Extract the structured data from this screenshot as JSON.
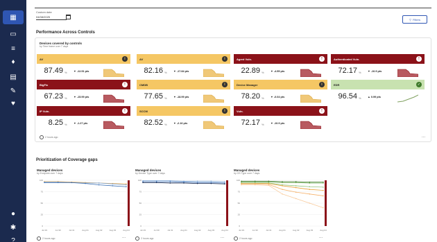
{
  "sidebar": {
    "icons": [
      "dashboard-icon",
      "devices-icon",
      "servers-icon",
      "alerts-icon",
      "reports-icon",
      "tools-icon",
      "shield-icon",
      "user-icon",
      "settings-icon",
      "help-icon"
    ]
  },
  "date_picker": {
    "label": "Custom date",
    "value": "04/08/2025"
  },
  "filters_label": "Filters",
  "performance": {
    "title": "Performance Across Controls",
    "card_title": "Devices covered by controls",
    "card_subtitle": "by Time frame over 7 days",
    "updated": "2 hours ago",
    "tiles": [
      {
        "name": "AV",
        "value": "87.49",
        "delta": "-12.51",
        "tone": "yellow",
        "status": "i",
        "trend": "down"
      },
      {
        "name": "AV",
        "value": "82.16",
        "delta": "-17.84",
        "tone": "yellow",
        "status": "i",
        "trend": "down"
      },
      {
        "name": "Agent Vuln.",
        "value": "22.89",
        "delta": "-4.55",
        "tone": "red",
        "status": "!",
        "trend": "down"
      },
      {
        "name": "Authenticated Vuln.",
        "value": "72.17",
        "delta": "-10.9",
        "tone": "red",
        "status": "!",
        "trend": "down"
      },
      {
        "name": "BigFix",
        "value": "67.23",
        "delta": "-15.99",
        "tone": "red",
        "status": "!",
        "trend": "down"
      },
      {
        "name": "CMDB",
        "value": "77.65",
        "delta": "-18.99",
        "tone": "yellow",
        "status": "i",
        "trend": "down"
      },
      {
        "name": "Device Manager",
        "value": "78.20",
        "delta": "-0.04",
        "tone": "yellow",
        "status": "i",
        "trend": "down"
      },
      {
        "name": "EDR",
        "value": "96.54",
        "delta": "0.99",
        "tone": "green",
        "status": "✓",
        "trend": "up"
      },
      {
        "name": "IP Vuln.",
        "value": "8.25",
        "delta": "-1.27",
        "tone": "red",
        "status": "!",
        "trend": "down"
      },
      {
        "name": "SCCM",
        "value": "82.52",
        "delta": "-2.16",
        "tone": "yellow",
        "status": "i",
        "trend": "down"
      },
      {
        "name": "Vuln.",
        "value": "72.17",
        "delta": "-10.9",
        "tone": "red",
        "status": "!",
        "trend": "down"
      }
    ],
    "pct_unit": "%",
    "delta_unit": "pts",
    "colors": {
      "yellow": "#f5c764",
      "red": "#8b1219",
      "green": "#c8e2b0",
      "nav": "#1b2a4e",
      "accent": "#2f56b3"
    }
  },
  "gaps": {
    "title": "Prioritization of Coverage gaps",
    "updated": "2 hours ago"
  },
  "chart_data": [
    {
      "type": "line",
      "title": "Managed devices",
      "subtitle": "by Endpoint over 7 days",
      "x": [
        "Jul 29",
        "Jul 30",
        "Jul 31",
        "Aug 01",
        "Aug 02",
        "Aug 03",
        "Aug 04"
      ],
      "ylim": [
        0,
        100
      ],
      "series": [
        {
          "values": [
            97,
            97,
            96,
            95,
            94,
            93,
            92
          ],
          "color": "#e8a23c"
        },
        {
          "values": [
            96,
            96,
            95,
            94,
            94,
            92,
            90
          ],
          "color": "#7fa8d8"
        },
        {
          "values": [
            95,
            95,
            95,
            93,
            90,
            88,
            86
          ],
          "color": "#3a6fb5"
        }
      ]
    },
    {
      "type": "line",
      "title": "Managed devices",
      "subtitle": "by Device Type over 7 days",
      "x": [
        "Jul 29",
        "Jul 30",
        "Jul 31",
        "Aug 01",
        "Aug 02",
        "Aug 03",
        "Aug 04"
      ],
      "ylim": [
        0,
        100
      ],
      "series": [
        {
          "values": [
            99,
            99,
            99,
            98,
            98,
            98,
            97
          ],
          "color": "#7fa8d8"
        },
        {
          "values": [
            97,
            97,
            97,
            96,
            95,
            95,
            94
          ],
          "color": "#3a6fb5"
        },
        {
          "values": [
            95,
            95,
            94,
            94,
            93,
            93,
            92
          ],
          "color": "#1b2a4e"
        }
      ]
    },
    {
      "type": "line",
      "title": "Managed devices",
      "subtitle": "by OS Type over 7 days",
      "x": [
        "Jul 29",
        "Jul 30",
        "Jul 31",
        "Aug 01",
        "Aug 02",
        "Aug 03",
        "Aug 04"
      ],
      "ylim": [
        0,
        100
      ],
      "series": [
        {
          "values": [
            98,
            98,
            98,
            97,
            97,
            96,
            96
          ],
          "color": "#3f7a2b"
        },
        {
          "values": [
            96,
            96,
            96,
            95,
            95,
            94,
            94
          ],
          "color": "#6aa84f"
        },
        {
          "values": [
            94,
            94,
            94,
            90,
            88,
            86,
            85
          ],
          "color": "#93c47d"
        },
        {
          "values": [
            93,
            93,
            93,
            88,
            84,
            80,
            78
          ],
          "color": "#e8a23c"
        },
        {
          "values": [
            92,
            92,
            91,
            80,
            74,
            70,
            66
          ],
          "color": "#f6b26b"
        },
        {
          "values": [
            90,
            90,
            89,
            70,
            60,
            50,
            40
          ],
          "color": "#f9cb9c"
        }
      ]
    }
  ]
}
